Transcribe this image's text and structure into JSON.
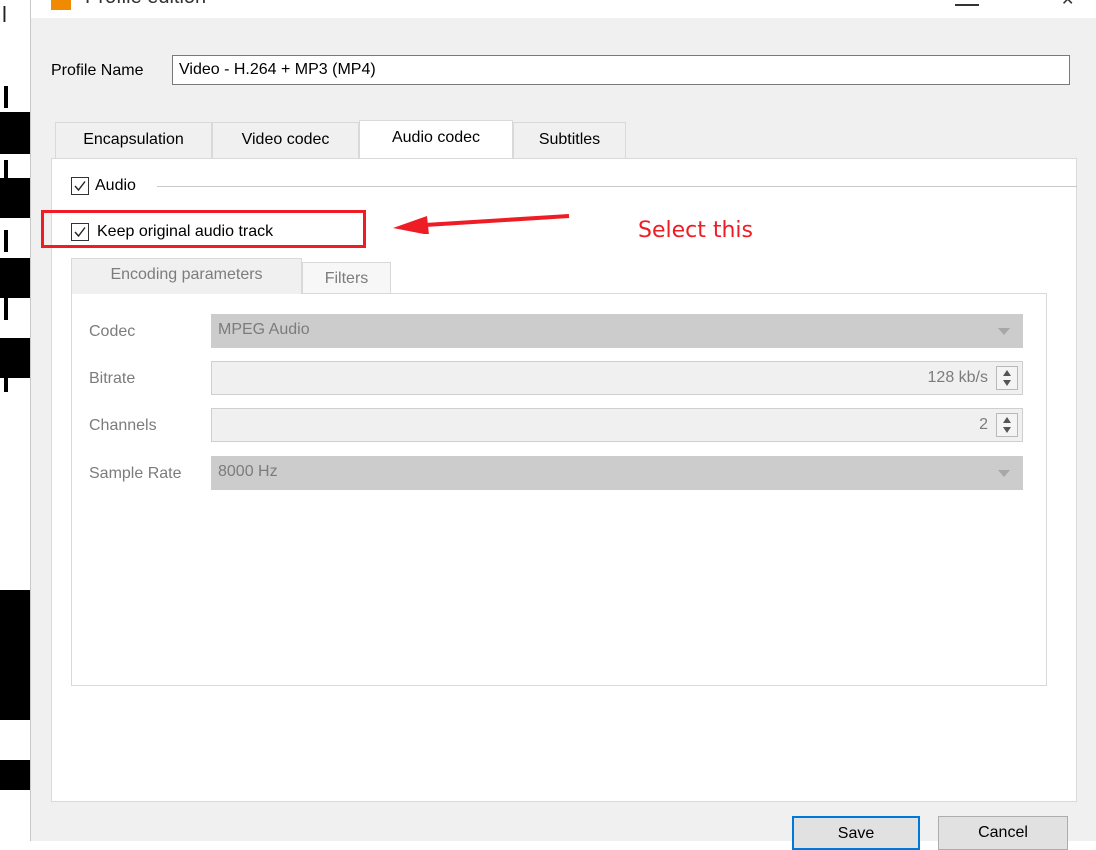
{
  "window": {
    "title": "Profile edition",
    "minimize_icon": "minimize-icon",
    "close_icon": "close-icon"
  },
  "profile": {
    "label": "Profile Name",
    "value": "Video - H.264 + MP3 (MP4)"
  },
  "tabs": [
    {
      "label": "Encapsulation",
      "active": false
    },
    {
      "label": "Video codec",
      "active": false
    },
    {
      "label": "Audio codec",
      "active": true
    },
    {
      "label": "Subtitles",
      "active": false
    }
  ],
  "audio": {
    "enable_label": "Audio",
    "enable_checked": true,
    "keep_original_label": "Keep original audio track",
    "keep_original_checked": true
  },
  "annotation": {
    "text": "Select this",
    "color": "#ee1c25"
  },
  "inner_tabs": [
    {
      "label": "Encoding parameters",
      "active": true
    },
    {
      "label": "Filters",
      "active": false
    }
  ],
  "fields": {
    "codec": {
      "label": "Codec",
      "value": "MPEG Audio"
    },
    "bitrate": {
      "label": "Bitrate",
      "value": "128 kb/s"
    },
    "channels": {
      "label": "Channels",
      "value": "2"
    },
    "sample_rate": {
      "label": "Sample Rate",
      "value": "8000 Hz"
    }
  },
  "buttons": {
    "save": "Save",
    "cancel": "Cancel"
  },
  "colors": {
    "accent": "#0078d7",
    "annotation_red": "#ee1c25",
    "disabled_text": "#7c7c7c"
  }
}
